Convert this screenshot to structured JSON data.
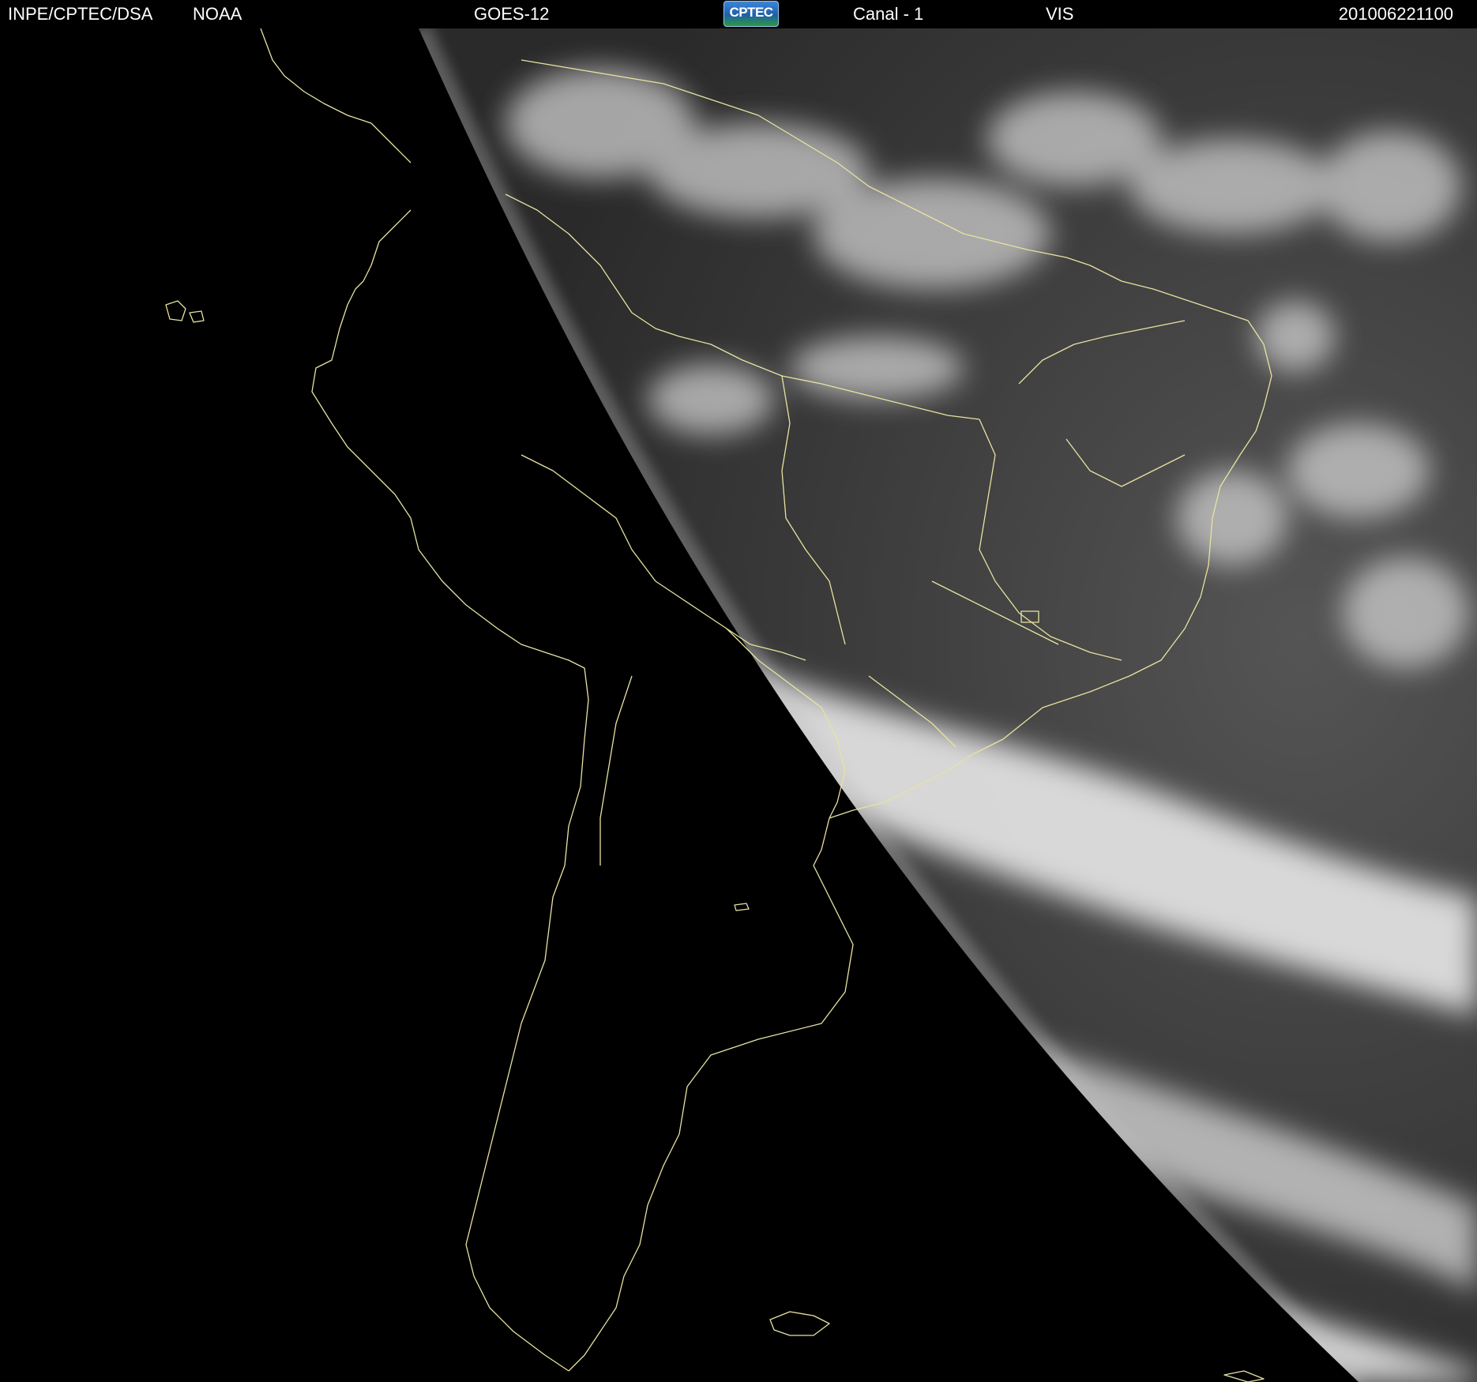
{
  "header": {
    "organization": "INPE/CPTEC/DSA",
    "agency": "NOAA",
    "satellite": "GOES-12",
    "logo_text": "CPTEC",
    "channel": "Canal - 1",
    "band": "VIS",
    "timestamp": "201006221100"
  },
  "image": {
    "description_type": "visible-band satellite image",
    "map_overlay_color": "#e8e3a0",
    "space_color": "#000000",
    "cloud_color": "#f2f2f2",
    "ocean_color": "#2b2b2b"
  }
}
